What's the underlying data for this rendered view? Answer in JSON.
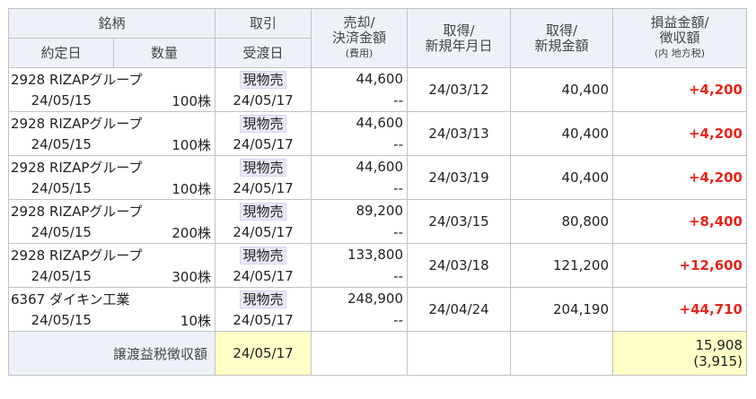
{
  "header": {
    "issue": "銘柄",
    "trade": "取引",
    "sell_line1": "売却/",
    "sell_line2": "決済金額",
    "sell_sub": "(費用)",
    "acq_date_line1": "取得/",
    "acq_date_line2": "新規年月日",
    "acq_amt_line1": "取得/",
    "acq_amt_line2": "新規金額",
    "pl_line1": "損益金額/",
    "pl_line2": "徴収額",
    "pl_sub": "(内 地方税)",
    "contract_date": "約定日",
    "quantity": "数量",
    "delivery_date": "受渡日"
  },
  "rows": [
    {
      "name": "2928 RIZAPグループ",
      "contract_date": "24/05/15",
      "quantity": "100株",
      "trade_type": "現物売",
      "delivery_date": "24/05/17",
      "sell_amount": "44,600",
      "fee": "--",
      "acq_date": "24/03/12",
      "acq_amount": "40,400",
      "pl": "+4,200"
    },
    {
      "name": "2928 RIZAPグループ",
      "contract_date": "24/05/15",
      "quantity": "100株",
      "trade_type": "現物売",
      "delivery_date": "24/05/17",
      "sell_amount": "44,600",
      "fee": "--",
      "acq_date": "24/03/13",
      "acq_amount": "40,400",
      "pl": "+4,200"
    },
    {
      "name": "2928 RIZAPグループ",
      "contract_date": "24/05/15",
      "quantity": "100株",
      "trade_type": "現物売",
      "delivery_date": "24/05/17",
      "sell_amount": "44,600",
      "fee": "--",
      "acq_date": "24/03/19",
      "acq_amount": "40,400",
      "pl": "+4,200"
    },
    {
      "name": "2928 RIZAPグループ",
      "contract_date": "24/05/15",
      "quantity": "200株",
      "trade_type": "現物売",
      "delivery_date": "24/05/17",
      "sell_amount": "89,200",
      "fee": "--",
      "acq_date": "24/03/15",
      "acq_amount": "80,800",
      "pl": "+8,400"
    },
    {
      "name": "2928 RIZAPグループ",
      "contract_date": "24/05/15",
      "quantity": "300株",
      "trade_type": "現物売",
      "delivery_date": "24/05/17",
      "sell_amount": "133,800",
      "fee": "--",
      "acq_date": "24/03/18",
      "acq_amount": "121,200",
      "pl": "+12,600"
    },
    {
      "name": "6367 ダイキン工業",
      "contract_date": "24/05/15",
      "quantity": "10株",
      "trade_type": "現物売",
      "delivery_date": "24/05/17",
      "sell_amount": "248,900",
      "fee": "--",
      "acq_date": "24/04/24",
      "acq_amount": "204,190",
      "pl": "+44,710"
    }
  ],
  "total": {
    "label": "譲渡益税徴収額",
    "date": "24/05/17",
    "tax": "15,908",
    "local_tax": "(3,915)"
  },
  "colors": {
    "header_bg": "#eef2f8",
    "profit_red": "#e8251b",
    "total_highlight": "#ffffc8",
    "trade_badge": "#e8e8f8"
  }
}
